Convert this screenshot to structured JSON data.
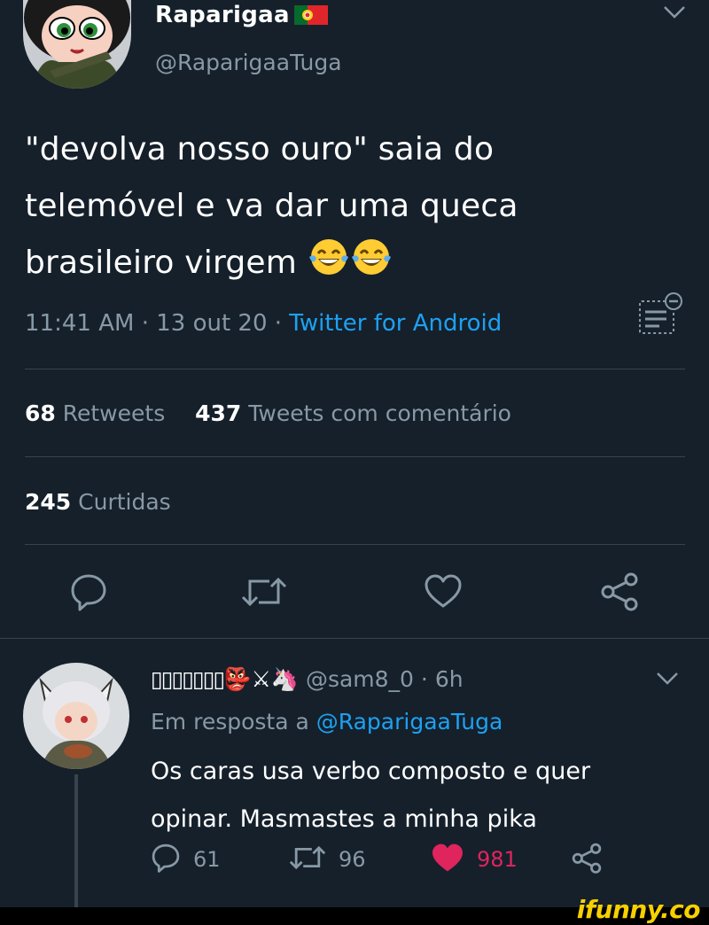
{
  "tweet": {
    "author_name": "Raparigaa",
    "author_handle": "@RaparigaaTuga",
    "text_lines": [
      "\"devolva nosso ouro\" saia do",
      "telemóvel e va dar uma queca",
      "brasileiro virgem"
    ],
    "emoji_count": 2,
    "time": "11:41 AM",
    "date": "13 out 20",
    "source": "Twitter for Android",
    "retweets_count": "68",
    "retweets_label": "Retweets",
    "quote_count": "437",
    "quote_label": "Tweets com comentário",
    "likes_count": "245",
    "likes_label": "Curtidas"
  },
  "reply": {
    "display_name": "▯▯▯▯▯▯▯",
    "emojis": "👺⚔🦄",
    "handle": "@sam8_0",
    "time": "6h",
    "in_reply_prefix": "Em resposta a",
    "in_reply_handle": "@RaparigaaTuga",
    "text_lines": [
      "Os caras usa verbo composto e quer",
      "opinar. Masmastes a minha pika"
    ],
    "reply_count": "61",
    "retweet_count": "96",
    "like_count": "981"
  },
  "watermark": "ifunny.co",
  "colors": {
    "background": "#15202b",
    "muted": "#8899a6",
    "link": "#1da1f2",
    "like_red": "#e0245e",
    "divider": "#38444d"
  },
  "icons": {
    "reply": "reply-icon",
    "retweet": "retweet-icon",
    "like": "heart-icon",
    "share": "share-icon",
    "analytics": "analytics-icon",
    "menu": "chevron-down-icon"
  }
}
